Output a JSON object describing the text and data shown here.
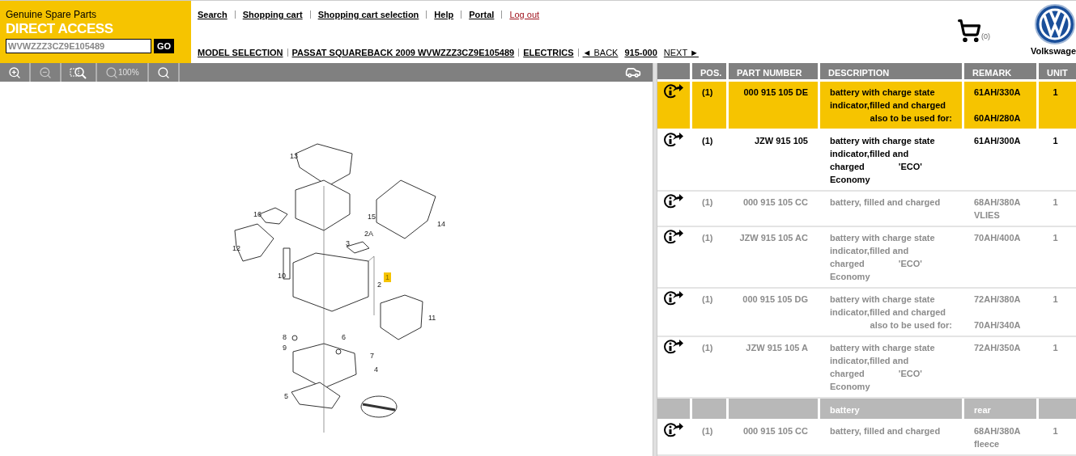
{
  "brand": {
    "subtitle": "Genuine Spare Parts",
    "title": "DIRECT ACCESS",
    "vin_field": {
      "value": "WVWZZZ3CZ9E105489"
    },
    "go_button": "GO"
  },
  "nav_links": [
    {
      "label": "Search",
      "kind": "normal"
    },
    {
      "label": "Shopping cart",
      "kind": "normal"
    },
    {
      "label": "Shopping cart selection",
      "kind": "normal"
    },
    {
      "label": "Help",
      "kind": "normal"
    },
    {
      "label": "Portal",
      "kind": "normal"
    },
    {
      "label": "Log out",
      "kind": "logout"
    }
  ],
  "breadcrumb": [
    {
      "label": "MODEL SELECTION"
    },
    {
      "label": "PASSAT SQUAREBACK 2009 WVWZZZ3CZ9E105489"
    },
    {
      "label": "ELECTRICS"
    }
  ],
  "pager": {
    "back": "◄ BACK",
    "current": "915-000",
    "next": "NEXT ►"
  },
  "cart": {
    "count": "(0)"
  },
  "logo": {
    "caption": "Volkswage"
  },
  "toolbar": [
    {
      "kind": "zoom-in",
      "disabled": false
    },
    {
      "kind": "zoom-out",
      "disabled": true
    },
    {
      "kind": "zoom-area",
      "disabled": false
    },
    {
      "kind": "zoom-100",
      "label": "100%",
      "disabled": true
    },
    {
      "kind": "search",
      "disabled": false
    }
  ],
  "diagram": {
    "callouts": [
      {
        "label": "13",
        "highlighted": false
      },
      {
        "label": "15",
        "highlighted": false
      },
      {
        "label": "14",
        "highlighted": false
      },
      {
        "label": "16",
        "highlighted": false
      },
      {
        "label": "12",
        "highlighted": false
      },
      {
        "label": "3",
        "highlighted": false
      },
      {
        "label": "2A",
        "highlighted": false
      },
      {
        "label": "10",
        "highlighted": false
      },
      {
        "label": "1",
        "highlighted": true
      },
      {
        "label": "2",
        "highlighted": false
      },
      {
        "label": "11",
        "highlighted": false
      },
      {
        "label": "8",
        "highlighted": false
      },
      {
        "label": "6",
        "highlighted": false
      },
      {
        "label": "9",
        "highlighted": false
      },
      {
        "label": "7",
        "highlighted": false
      },
      {
        "label": "4",
        "highlighted": false
      },
      {
        "label": "5",
        "highlighted": false
      }
    ]
  },
  "table": {
    "columns": [
      "POS.",
      "PART NUMBER",
      "DESCRIPTION",
      "REMARK",
      "UNIT"
    ],
    "rows": [
      {
        "kind": "part",
        "selected": true,
        "dimmed": false,
        "pos": "(1)",
        "part_number": "000 915 105 DE",
        "description": [
          {
            "text": "battery with charge state",
            "kind": "plain"
          },
          {
            "text": "indicator,filled and charged",
            "kind": "plain"
          },
          {
            "text": "also to be used for:",
            "kind": "note"
          }
        ],
        "remark": [
          {
            "text": "61AH/330A",
            "kind": "main"
          },
          {
            "text": "60AH/280A",
            "kind": "alt"
          }
        ],
        "unit": "1"
      },
      {
        "kind": "part",
        "selected": false,
        "dimmed": false,
        "pos": "(1)",
        "part_number": "JZW 915 105",
        "description": [
          {
            "text": "battery with charge state",
            "kind": "plain"
          },
          {
            "text": "indicator,filled and",
            "kind": "plain"
          },
          {
            "text": "charged",
            "kind": "plain",
            "tag": "'ECO'"
          },
          {
            "text": "Economy",
            "kind": "plain"
          }
        ],
        "remark": [
          {
            "text": "61AH/300A",
            "kind": "main"
          }
        ],
        "unit": "1"
      },
      {
        "kind": "part",
        "selected": false,
        "dimmed": true,
        "pos": "(1)",
        "part_number": "000 915 105 CC",
        "description": [
          {
            "text": "battery, filled and charged",
            "kind": "plain"
          }
        ],
        "remark": [
          {
            "text": "68AH/380A",
            "kind": "main"
          },
          {
            "text": "VLIES",
            "kind": "main"
          }
        ],
        "unit": "1"
      },
      {
        "kind": "part",
        "selected": false,
        "dimmed": true,
        "pos": "(1)",
        "part_number": "JZW 915 105 AC",
        "description": [
          {
            "text": "battery with charge state",
            "kind": "plain"
          },
          {
            "text": "indicator,filled and",
            "kind": "plain"
          },
          {
            "text": "charged",
            "kind": "plain",
            "tag": "'ECO'"
          },
          {
            "text": "Economy",
            "kind": "plain"
          }
        ],
        "remark": [
          {
            "text": "70AH/400A",
            "kind": "main"
          }
        ],
        "unit": "1"
      },
      {
        "kind": "part",
        "selected": false,
        "dimmed": true,
        "pos": "(1)",
        "part_number": "000 915 105 DG",
        "description": [
          {
            "text": "battery with charge state",
            "kind": "plain"
          },
          {
            "text": "indicator,filled and charged",
            "kind": "plain"
          },
          {
            "text": "also to be used for:",
            "kind": "note"
          }
        ],
        "remark": [
          {
            "text": "72AH/380A",
            "kind": "main"
          },
          {
            "text": "70AH/340A",
            "kind": "alt"
          }
        ],
        "unit": "1"
      },
      {
        "kind": "part",
        "selected": false,
        "dimmed": true,
        "pos": "(1)",
        "part_number": "JZW 915 105 A",
        "description": [
          {
            "text": "battery with charge state",
            "kind": "plain"
          },
          {
            "text": "indicator,filled and",
            "kind": "plain"
          },
          {
            "text": "charged",
            "kind": "plain",
            "tag": "'ECO'"
          },
          {
            "text": "Economy",
            "kind": "plain"
          }
        ],
        "remark": [
          {
            "text": "72AH/350A",
            "kind": "main"
          }
        ],
        "unit": "1"
      },
      {
        "kind": "group",
        "title": "battery",
        "remark": "rear"
      },
      {
        "kind": "part",
        "selected": false,
        "dimmed": true,
        "pos": "(1)",
        "part_number": "000 915 105 CC",
        "description": [
          {
            "text": "battery, filled and charged",
            "kind": "plain"
          }
        ],
        "remark": [
          {
            "text": "68AH/380A",
            "kind": "main"
          },
          {
            "text": "fleece",
            "kind": "main"
          }
        ],
        "unit": "1"
      }
    ]
  }
}
